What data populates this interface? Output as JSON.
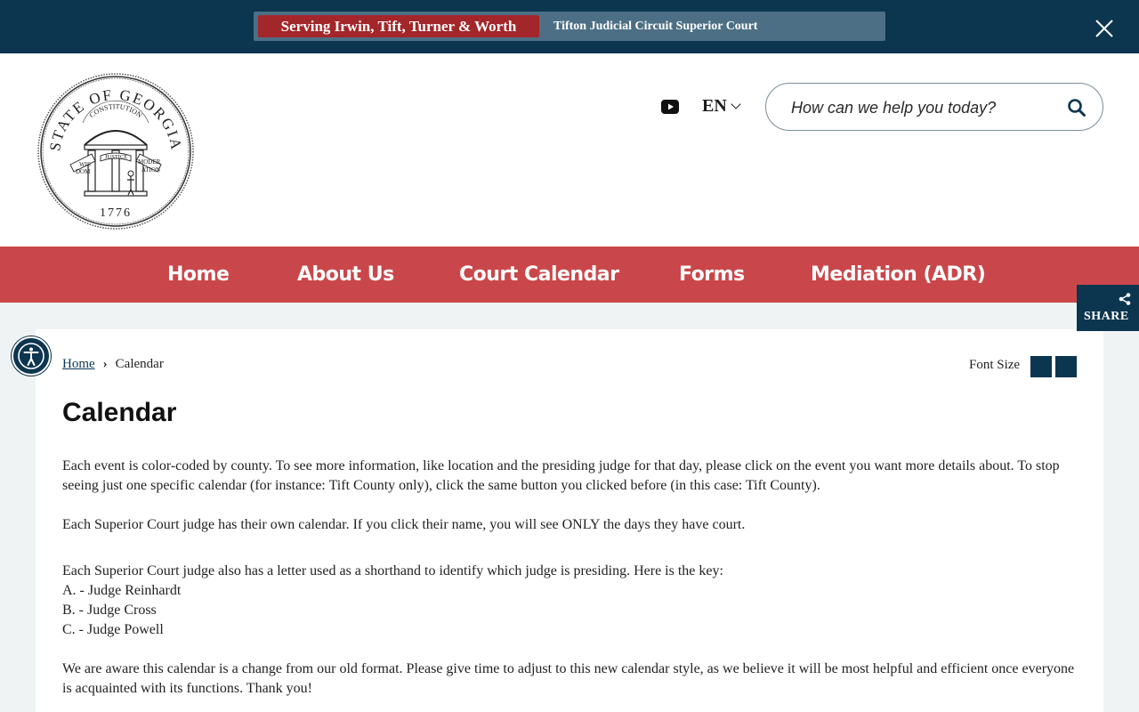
{
  "banner": {
    "tag": "Serving Irwin, Tift, Turner & Worth",
    "text": "Tifton Judicial Circuit Superior Court"
  },
  "header": {
    "seal": {
      "top": "STATE OF GEORGIA",
      "ribbon": "CONSTITUTION",
      "left": "WIS",
      "left2": "DOM",
      "center": "JUSTICE",
      "right": "MODER",
      "right2": "ATION",
      "year": "1776"
    },
    "language": "EN",
    "search_placeholder": "How can we help you today?"
  },
  "nav": {
    "items": [
      "Home",
      "About Us",
      "Court Calendar",
      "Forms",
      "Mediation (ADR)"
    ]
  },
  "share_label": "SHARE",
  "breadcrumb": {
    "home": "Home",
    "separator": "›",
    "current": "Calendar"
  },
  "font_size_label": "Font Size",
  "page": {
    "title": "Calendar",
    "paragraph1": "Each event is color-coded by county. To see more information, like location and the presiding judge for that day, please click on the event you want more details about. To stop seeing just one specific calendar (for instance: Tift County only), click the same button you clicked before (in this case: Tift County).",
    "paragraph2": "Each Superior Court judge has their own calendar. If you click their name, you will see ONLY the days they have court.",
    "paragraph3": "Each Superior Court judge also has a letter used as a shorthand to identify which judge is presiding. Here is the key:",
    "key": [
      "A. - Judge Reinhardt",
      "B. - Judge Cross",
      "C. - Judge Powell"
    ],
    "paragraph4": "We are aware this calendar is a change from our old format. Please give time to adjust to this new calendar style, as we believe it will be most helpful and efficient once everyone is acquainted with its functions. Thank you!"
  },
  "colors": {
    "navy": "#0c3550",
    "nav_red": "#c9474a",
    "banner_red": "#a3262a"
  }
}
